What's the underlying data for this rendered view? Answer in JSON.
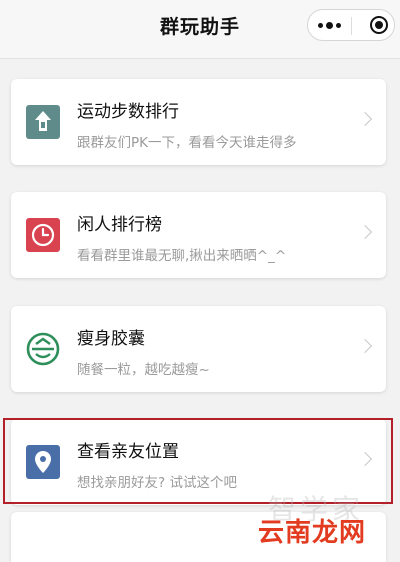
{
  "app": {
    "title": "群玩助手"
  },
  "capsule": {
    "more_icon": "more-dots-icon",
    "close_icon": "miniprogram-close-icon"
  },
  "items": [
    {
      "title": "运动步数排行",
      "subtitle": "跟群友们PK一下，看看今天谁走得多",
      "icon": "step-ranking-icon",
      "icon_color": "#5f8c8a"
    },
    {
      "title": "闲人排行榜",
      "subtitle": "看看群里谁最无聊,揪出来晒晒^_^",
      "icon": "clock-icon",
      "icon_color": "#d8434f"
    },
    {
      "title": "瘦身胶囊",
      "subtitle": "随餐一粒，越吃越瘦~",
      "icon": "capsule-icon",
      "icon_color": "#2f8f5a"
    },
    {
      "title": "查看亲友位置",
      "subtitle": "想找亲朋好友? 试试这个吧",
      "icon": "location-pin-icon",
      "icon_color": "#4a6fa8"
    }
  ],
  "highlight_color": "#b3202a",
  "watermark": {
    "faint": "智学家",
    "main": "云南龙网"
  }
}
